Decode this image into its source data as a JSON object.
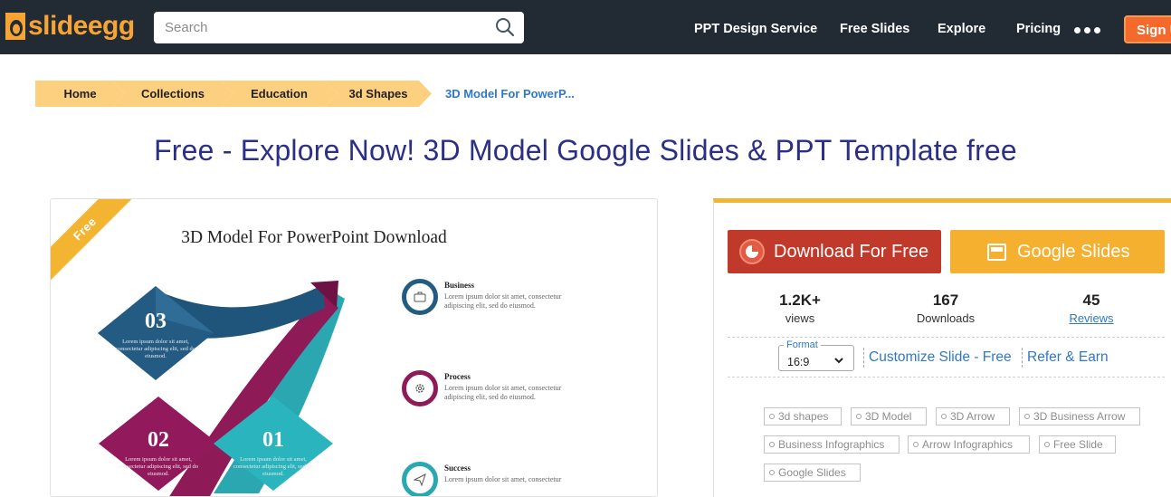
{
  "header": {
    "logo_text": "slideegg",
    "search_placeholder": "Search",
    "nav": [
      "PPT Design Service",
      "Free Slides",
      "Explore",
      "Pricing"
    ],
    "signup_label": "Sign Up"
  },
  "breadcrumb": {
    "items": [
      "Home",
      "Collections",
      "Education",
      "3d Shapes"
    ],
    "current": "3D Model For PowerP..."
  },
  "page_title": "Free - Explore Now! 3D Model Google Slides & PPT Template free",
  "preview": {
    "ribbon": "Free",
    "slide_title": "3D Model For PowerPoint Download",
    "items": [
      {
        "title": "Business",
        "desc": "Lorem ipsum dolor sit amet, consectetur adipiscing elit, sed do eiusmod."
      },
      {
        "title": "Process",
        "desc": "Lorem ipsum dolor sit amet, consectetur adipiscing elit, sed do eiusmod."
      },
      {
        "title": "Success",
        "desc": "Lorem ipsum dolor sit amet, consectetur"
      }
    ],
    "numbers": [
      {
        "num": "03",
        "desc": "Lorem ipsum dolor sit amet, consectetur adipiscing elit, sed do eiusmod."
      },
      {
        "num": "02",
        "desc": "Lorem ipsum dolor sit amet, consectetur adipiscing elit, sed do eiusmod."
      },
      {
        "num": "01",
        "desc": "Lorem ipsum dolor sit amet, consectetur adipiscing elit, sed do eiusmod."
      }
    ]
  },
  "actions": {
    "download_label": "Download For Free",
    "google_label": "Google Slides"
  },
  "stats": [
    {
      "value": "1.2K+",
      "label": "views"
    },
    {
      "value": "167",
      "label": "Downloads"
    },
    {
      "value": "45",
      "label": "Reviews"
    }
  ],
  "format": {
    "label": "Format",
    "value": "16:9"
  },
  "links": {
    "customize": "Customize Slide - Free",
    "refer": "Refer & Earn"
  },
  "tags": [
    "3d shapes",
    "3D Model",
    "3D Arrow",
    "3D Business Arrow",
    "Business Infographics",
    "Arrow Infographics",
    "Free Slide",
    "Google Slides"
  ],
  "colors": {
    "header_bg": "#222a34",
    "accent_orange": "#f7a434",
    "breadcrumb_bg": "#fdd080",
    "title_blue": "#2c2f86",
    "download_red": "#c0392b",
    "google_yellow": "#f5b02f",
    "link_blue": "#2f78c8"
  }
}
